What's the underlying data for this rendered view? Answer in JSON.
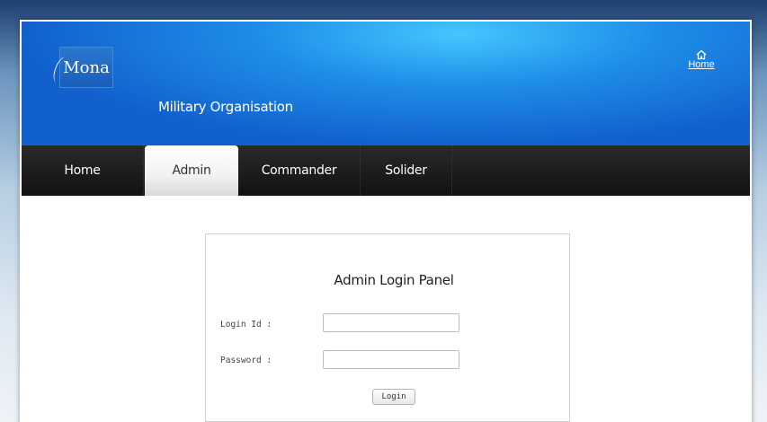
{
  "header": {
    "logo_text": "Mona",
    "organisation": "Military Organisation",
    "home_link": "Home"
  },
  "nav": {
    "items": [
      {
        "label": "Home",
        "active": false
      },
      {
        "label": "Admin",
        "active": true
      },
      {
        "label": "Commander",
        "active": false
      },
      {
        "label": "Solider",
        "active": false
      }
    ]
  },
  "login_panel": {
    "title": "Admin Login Panel",
    "login_id_label": "Login Id :",
    "login_id_value": "",
    "password_label": "Password :",
    "password_value": "",
    "submit_label": "Login"
  },
  "colors": {
    "header_blue": "#1f8ee8",
    "nav_dark": "#111111",
    "active_tab": "#f2f2f2"
  },
  "icons": {
    "home_link_icon": "home-icon"
  }
}
